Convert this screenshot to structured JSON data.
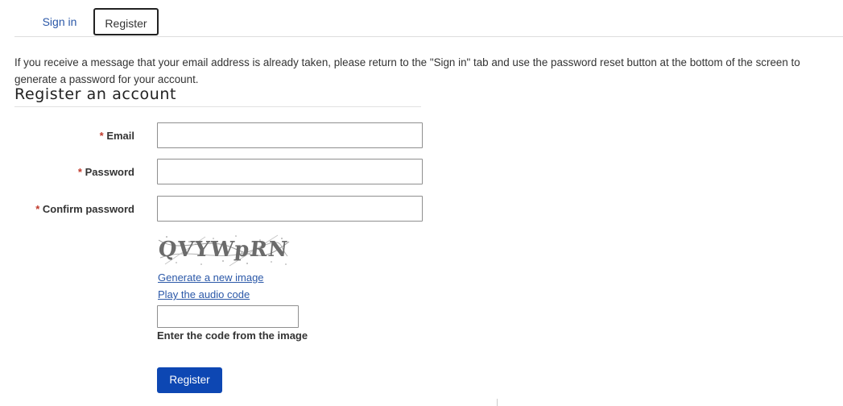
{
  "tabs": {
    "sign_in": "Sign in",
    "register": "Register"
  },
  "info_text": "If you receive a message that your email address is already taken, please return to the \"Sign in\" tab and use the password reset button at the bottom of the screen to generate a password for your account.",
  "form": {
    "title": "Register an account",
    "required_marker": "*",
    "email_label": "Email",
    "password_label": "Password",
    "confirm_password_label": "Confirm password",
    "email_value": "",
    "password_value": "",
    "confirm_password_value": ""
  },
  "captcha": {
    "image_text": "QVYWpRN",
    "generate_link": "Generate a new image",
    "audio_link": "Play the audio code",
    "code_value": "",
    "code_label": "Enter the code from the image"
  },
  "submit_label": "Register",
  "colors": {
    "link": "#2b58a8",
    "primary_button": "#0d47b3",
    "required": "#c0392b"
  }
}
